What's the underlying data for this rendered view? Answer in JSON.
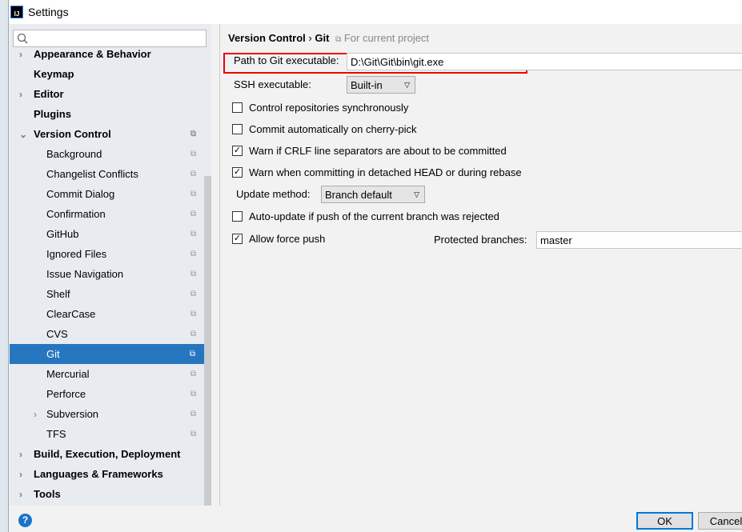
{
  "window": {
    "title": "Settings"
  },
  "sidebar": {
    "search_placeholder": "",
    "items": [
      {
        "label": "Appearance & Behavior",
        "bold": true,
        "arrow": true
      },
      {
        "label": "Keymap",
        "bold": true
      },
      {
        "label": "Editor",
        "bold": true,
        "arrow": true
      },
      {
        "label": "Plugins",
        "bold": true
      },
      {
        "label": "Version Control",
        "bold": true,
        "expanded": true,
        "copy": true
      },
      {
        "label": "Background",
        "copy": true
      },
      {
        "label": "Changelist Conflicts",
        "copy": true
      },
      {
        "label": "Commit Dialog",
        "copy": true
      },
      {
        "label": "Confirmation",
        "copy": true
      },
      {
        "label": "GitHub",
        "copy": true
      },
      {
        "label": "Ignored Files",
        "copy": true
      },
      {
        "label": "Issue Navigation",
        "copy": true
      },
      {
        "label": "Shelf",
        "copy": true
      },
      {
        "label": "ClearCase",
        "copy": true
      },
      {
        "label": "CVS",
        "copy": true
      },
      {
        "label": "Git",
        "copy": true,
        "selected": true
      },
      {
        "label": "Mercurial",
        "copy": true
      },
      {
        "label": "Perforce",
        "copy": true
      },
      {
        "label": "Subversion",
        "copy": true,
        "arrow": true
      },
      {
        "label": "TFS",
        "copy": true
      },
      {
        "label": "Build, Execution, Deployment",
        "bold": true,
        "arrow": true
      },
      {
        "label": "Languages & Frameworks",
        "bold": true,
        "arrow": true
      },
      {
        "label": "Tools",
        "bold": true,
        "arrow": true
      }
    ]
  },
  "main": {
    "breadcrumb": {
      "parent": "Version Control",
      "sep": "›",
      "current": "Git",
      "scope": "For current project"
    },
    "git_path": {
      "label": "Path to Git executable:",
      "value": "D:\\Git\\Git\\bin\\git.exe"
    },
    "ssh": {
      "label": "SSH executable:",
      "value": "Built-in"
    },
    "options": [
      {
        "label": "Control repositories synchronously",
        "checked": false
      },
      {
        "label": "Commit automatically on cherry-pick",
        "checked": false
      },
      {
        "label": "Warn if CRLF line separators are about to be committed",
        "checked": true
      },
      {
        "label": "Warn when committing in detached HEAD or during rebase",
        "checked": true
      }
    ],
    "update_method": {
      "label": "Update method:",
      "value": "Branch default"
    },
    "auto_update": {
      "label": "Auto-update if push of the current branch was rejected",
      "checked": false
    },
    "force_push": {
      "label": "Allow force push",
      "checked": true
    },
    "protected": {
      "label": "Protected branches:",
      "value": "master"
    }
  },
  "footer": {
    "help": "?",
    "ok": "OK",
    "cancel": "Cancel"
  },
  "colors": {
    "selection": "#2675bf",
    "highlight_box": "#e00000"
  }
}
